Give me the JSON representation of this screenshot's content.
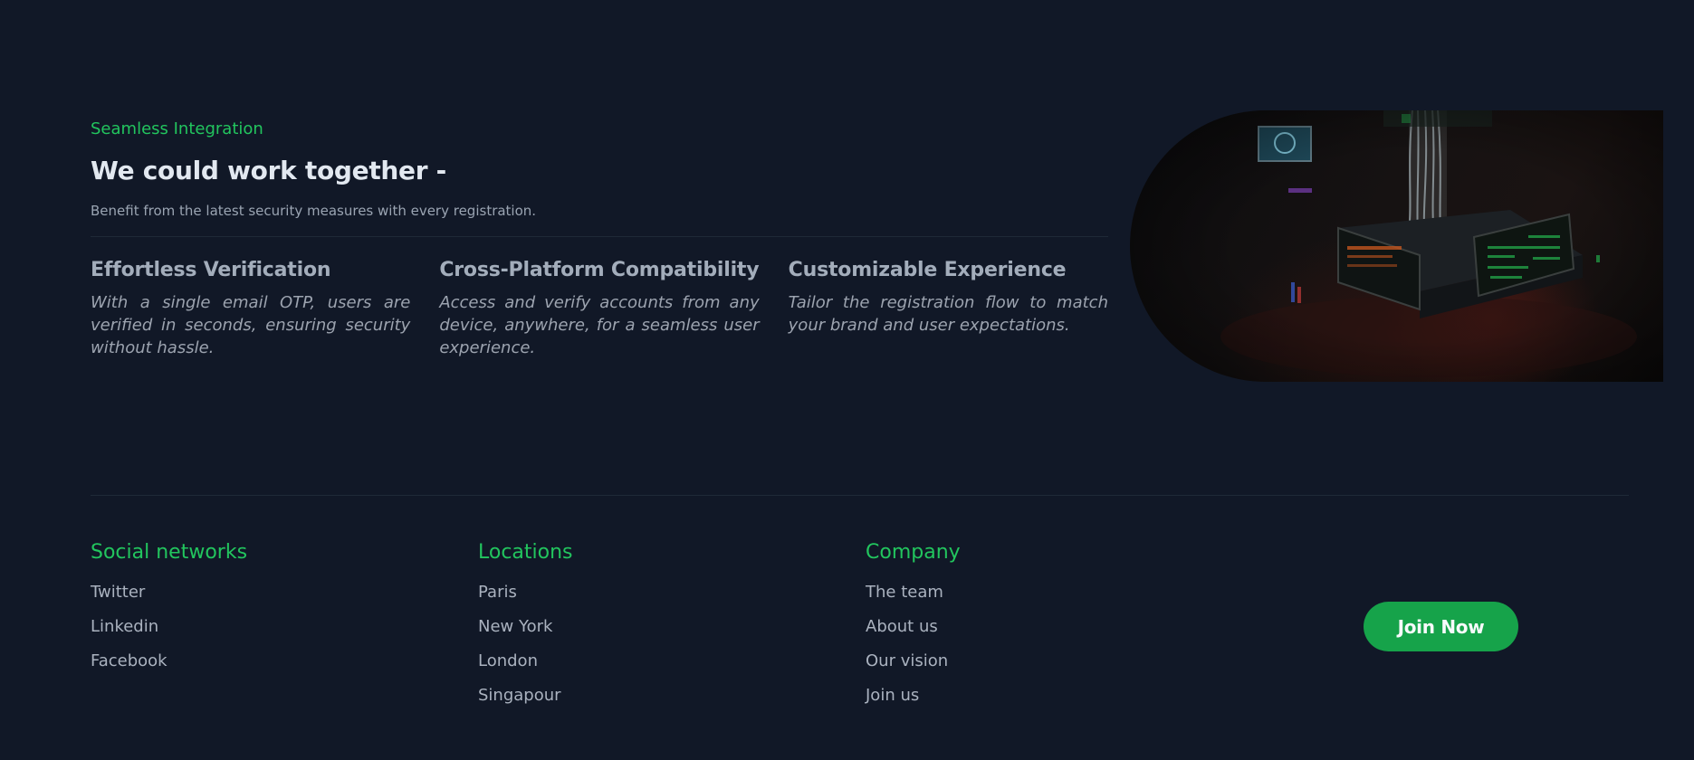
{
  "integration": {
    "eyebrow": "Seamless Integration",
    "headline": "We could work together -",
    "subtitle": "Benefit from the latest security measures with every registration.",
    "features": [
      {
        "title": "Effortless Verification",
        "description": "With a single email OTP, users are verified in seconds, ensuring security without hassle."
      },
      {
        "title": "Cross-Platform Compatibility",
        "description": "Access and verify accounts from any device, anywhere, for a seamless user experience."
      },
      {
        "title": "Customizable Experience",
        "description": "Tailor the registration flow to match your brand and user expectations."
      }
    ]
  },
  "hero_image": {
    "icon": "server-room-photo"
  },
  "footer": {
    "social": {
      "heading": "Social networks",
      "links": [
        "Twitter",
        "Linkedin",
        "Facebook"
      ]
    },
    "locations": {
      "heading": "Locations",
      "links": [
        "Paris",
        "New York",
        "London",
        "Singapour"
      ]
    },
    "company": {
      "heading": "Company",
      "links": [
        "The team",
        "About us",
        "Our vision",
        "Join us"
      ]
    },
    "cta_label": "Join Now"
  },
  "colors": {
    "background": "#111827",
    "accent": "#22c55e",
    "button": "#16a34a"
  }
}
